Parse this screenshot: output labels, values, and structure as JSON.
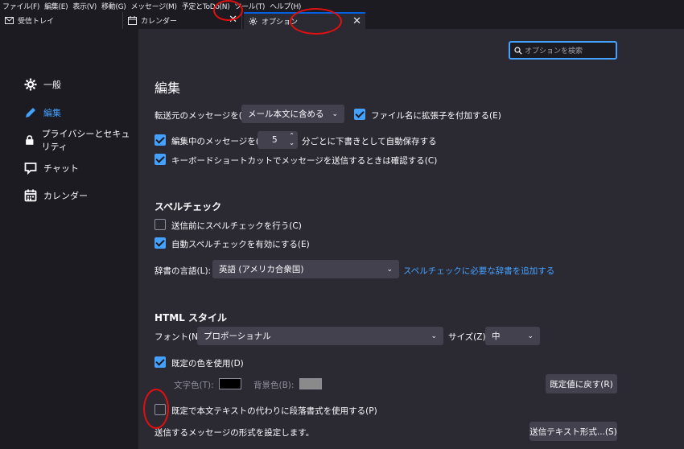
{
  "menubar": [
    "ファイル(F)",
    "編集(E)",
    "表示(V)",
    "移動(G)",
    "メッセージ(M)",
    "予定とToDo(N)",
    "ツール(T)",
    "ヘルプ(H)"
  ],
  "tabs": [
    {
      "label": "受信トレイ",
      "icon": "mail-icon"
    },
    {
      "label": "カレンダー",
      "icon": "calendar-icon"
    },
    {
      "label": "オプション",
      "icon": "gear-icon"
    }
  ],
  "close_glyph": "✕",
  "search": {
    "placeholder": "オプションを検索"
  },
  "sidebar": {
    "items": [
      {
        "label": "一般",
        "icon": "gear-icon"
      },
      {
        "label": "編集",
        "icon": "pencil-icon",
        "active": true
      },
      {
        "label": "プライバシーとセキュリティ",
        "icon": "lock-icon"
      },
      {
        "label": "チャット",
        "icon": "chat-icon"
      },
      {
        "label": "カレンダー",
        "icon": "calendar-icon"
      }
    ]
  },
  "main": {
    "title": "編集",
    "forward_label": "転送元のメッセージを(F):",
    "forward_value": "メール本文に含める",
    "add_ext_label": "ファイル名に拡張子を付加する(E)",
    "autosave_label": "編集中のメッセージを(A)",
    "autosave_value": "5",
    "autosave_suffix": "分ごとに下書きとして自動保存する",
    "confirm_shortcut_label": "キーボードショートカットでメッセージを送信するときは確認する(C)",
    "spell_title": "スペルチェック",
    "spell_before_send": "送信前にスペルチェックを行う(C)",
    "spell_auto": "自動スペルチェックを有効にする(E)",
    "dict_label": "辞書の言語(L):",
    "dict_value": "英語 (アメリカ合衆国)",
    "dict_link": "スペルチェックに必要な辞書を追加する",
    "html_title": "HTML スタイル",
    "font_label": "フォント(N):",
    "font_value": "プロポーショナル",
    "size_label": "サイズ(Z):",
    "size_value": "中",
    "use_default_colors": "既定の色を使用(D)",
    "text_color_label": "文字色(T):",
    "bg_color_label": "背景色(B):",
    "restore_defaults": "既定値に戻す(R)",
    "paragraph_format": "既定で本文テキストの代わりに段落書式を使用する(P)",
    "send_format_desc": "送信するメッセージの形式を設定します。",
    "send_format_button": "送信テキスト形式...(S)"
  },
  "colors": {
    "accent": "#45a1ff",
    "text_color": "#000000",
    "bg_color": "#8a8a8a"
  }
}
